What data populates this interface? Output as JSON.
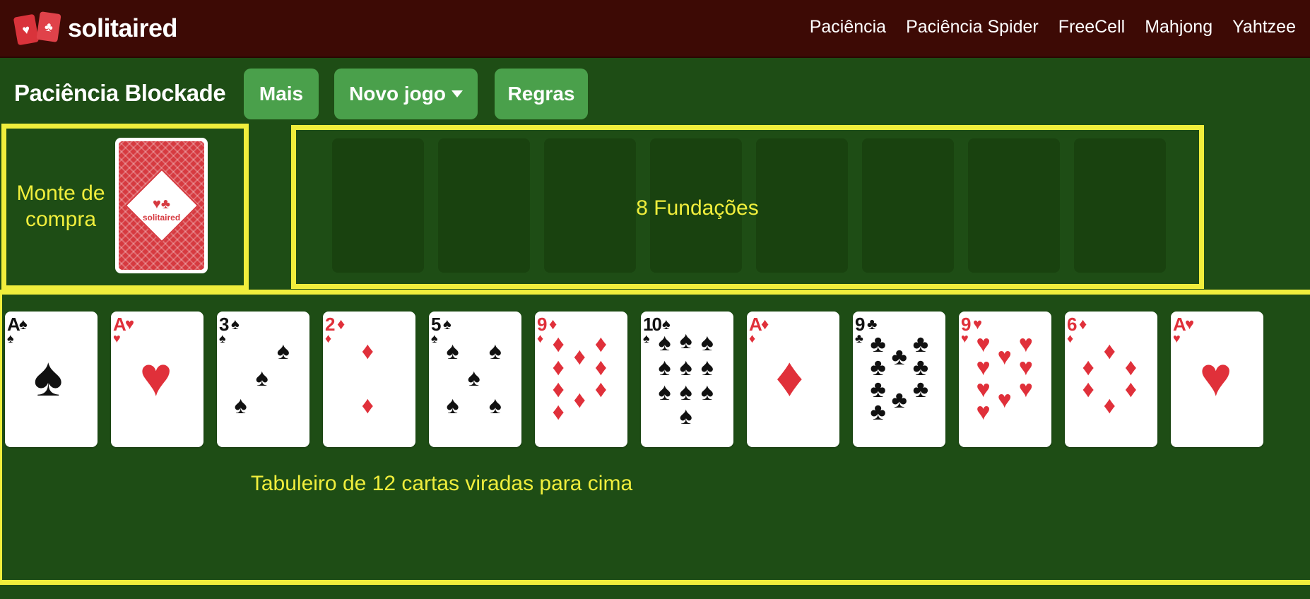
{
  "header": {
    "logo_text": "solitaired",
    "logo_card_suits": [
      "♥",
      "♣"
    ],
    "nav": [
      "Paciência",
      "Paciência Spider",
      "FreeCell",
      "Mahjong",
      "Yahtzee"
    ]
  },
  "game": {
    "title": "Paciência Blockade",
    "buttons": {
      "more": "Mais",
      "new_game": "Novo jogo",
      "rules": "Regras"
    }
  },
  "stock": {
    "logo_text": "solitaired",
    "logo_suits": "♥♣"
  },
  "annotations": {
    "stock_label": "Monte de compra",
    "foundations_label": "8 Fundações",
    "tableau_label": "Tabuleiro de 12 cartas viradas para cima"
  },
  "foundations_count": 8,
  "tableau": [
    {
      "rank": "A",
      "suit": "♠",
      "color": "black"
    },
    {
      "rank": "A",
      "suit": "♥",
      "color": "red"
    },
    {
      "rank": "3",
      "suit": "♠",
      "color": "black"
    },
    {
      "rank": "2",
      "suit": "♦",
      "color": "red"
    },
    {
      "rank": "5",
      "suit": "♠",
      "color": "black"
    },
    {
      "rank": "9",
      "suit": "♦",
      "color": "red"
    },
    {
      "rank": "10",
      "suit": "♠",
      "color": "black"
    },
    {
      "rank": "A",
      "suit": "♦",
      "color": "red"
    },
    {
      "rank": "9",
      "suit": "♣",
      "color": "black"
    },
    {
      "rank": "9",
      "suit": "♥",
      "color": "red"
    },
    {
      "rank": "6",
      "suit": "♦",
      "color": "red"
    },
    {
      "rank": "A",
      "suit": "♥",
      "color": "red"
    }
  ],
  "colors": {
    "felt": "#1e4d15",
    "header": "#3d0a05",
    "button": "#4aa04b",
    "highlight": "#f0ee3c",
    "card_red": "#e0303a"
  }
}
